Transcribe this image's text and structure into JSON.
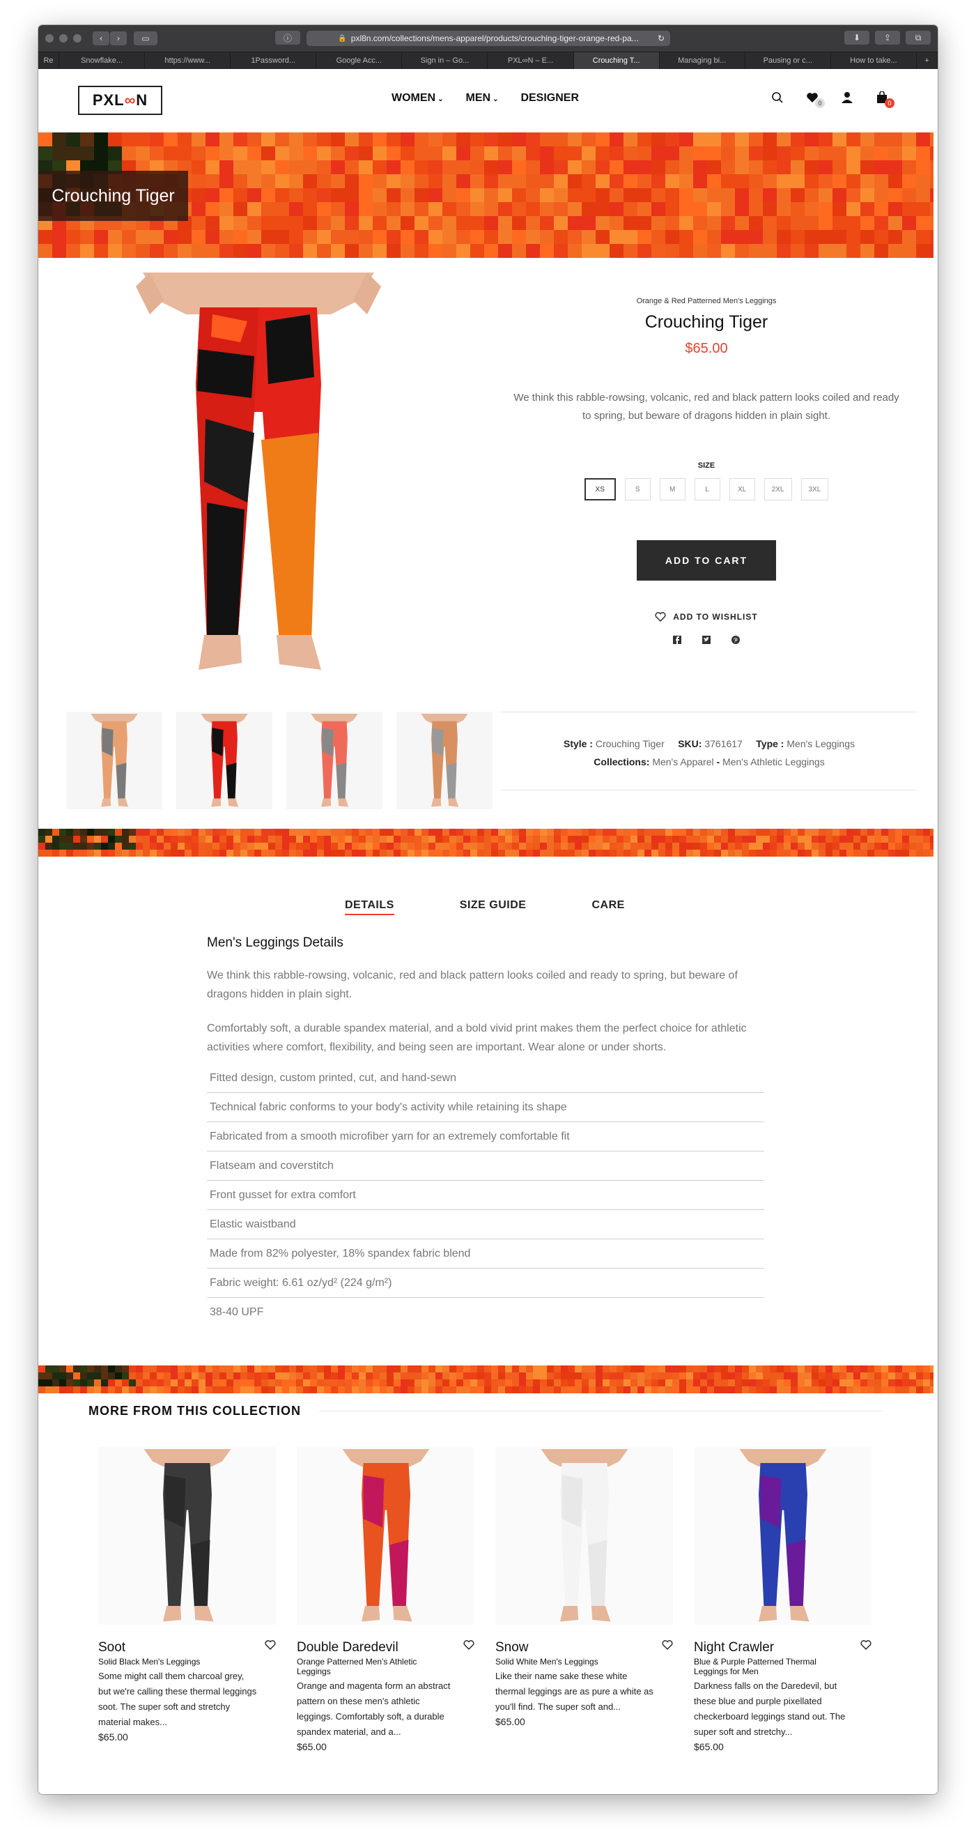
{
  "browser": {
    "url": "pxl8n.com/collections/mens-apparel/products/crouching-tiger-orange-red-pa...",
    "tabs": [
      "Re",
      "Snowflake...",
      "https://www...",
      "1Password...",
      "Google Acc...",
      "Sign in – Go...",
      "PXL∞N – E...",
      "Crouching T...",
      "Managing bi...",
      "Pausing or c...",
      "How to take..."
    ],
    "active_tab": 7,
    "new_tab": "+"
  },
  "header": {
    "logo_left": "PXL",
    "logo_mid": "∞",
    "logo_right": "N",
    "nav": [
      "WOMEN",
      "MEN",
      "DESIGNER"
    ],
    "nav_chevron": "⌄",
    "wishlist_count": "0",
    "cart_count": "0"
  },
  "hero": {
    "title": "Crouching Tiger"
  },
  "product": {
    "subtitle": "Orange & Red Patterned Men's Leggings",
    "title": "Crouching Tiger",
    "price": "$65.00",
    "description": "We think this rabble-rowsing, volcanic, red and black pattern looks coiled and ready to spring, but beware of dragons hidden in plain sight.",
    "size_label": "SIZE",
    "sizes": [
      "XS",
      "S",
      "M",
      "L",
      "XL",
      "2XL",
      "3XL"
    ],
    "selected_size": "XS",
    "add_to_cart": "ADD TO CART",
    "wishlist": "ADD TO WISHLIST",
    "meta": {
      "style_label": "Style :",
      "style_value": "Crouching Tiger",
      "sku_label": "SKU:",
      "sku_value": "3761617",
      "type_label": "Type :",
      "type_value": "Men's Leggings",
      "collections_label": "Collections:",
      "collection_1": "Men's Apparel",
      "collection_sep": "-",
      "collection_2": "Men's Athletic Leggings"
    }
  },
  "details": {
    "tabs": [
      "DETAILS",
      "SIZE GUIDE",
      "CARE"
    ],
    "heading": "Men's Leggings Details",
    "para1": "We think this rabble-rowsing, volcanic, red and black pattern looks coiled and ready to spring, but beware of dragons hidden in plain sight.",
    "para2": "Comfortably soft, a durable spandex material, and a bold vivid print makes them the perfect choice for athletic activities where comfort, flexibility, and being seen are important. Wear alone or under shorts.",
    "features": [
      "Fitted design, custom printed, cut, and hand-sewn",
      "Technical fabric conforms to your body's activity while retaining its shape",
      "Fabricated from a smooth microfiber yarn for an extremely comfortable fit",
      "Flatseam and coverstitch",
      "Front gusset for extra comfort",
      "Elastic waistband",
      "Made from 82% polyester, 18% spandex fabric blend",
      "Fabric weight: 6.61 oz/yd² (224 g/m²)",
      "38-40 UPF"
    ]
  },
  "collection": {
    "heading": "MORE FROM THIS COLLECTION",
    "items": [
      {
        "title": "Soot",
        "subtitle": "Solid Black Men's Leggings",
        "desc": "Some might call them charcoal grey, but we're calling these thermal leggings soot. The super soft and stretchy material makes...",
        "price": "$65.00",
        "color": "#3a3a3a"
      },
      {
        "title": "Double Daredevil",
        "subtitle": "Orange Patterned Men's Athletic Leggings",
        "desc": "Orange and magenta form an abstract pattern on these men's athletic leggings. Comfortably soft, a durable spandex material, and a...",
        "price": "$65.00",
        "color": "#e8531f"
      },
      {
        "title": "Snow",
        "subtitle": "Solid White Men's Leggings",
        "desc": "Like their name sake these white thermal leggings are as pure a white as you'll find. The super soft and...",
        "price": "$65.00",
        "color": "#f4f4f4"
      },
      {
        "title": "Night Crawler",
        "subtitle": "Blue & Purple Patterned Thermal Leggings for Men",
        "desc": "Darkness falls on the Daredevil, but these blue and purple pixellated checkerboard leggings stand out. The super soft and stretchy...",
        "price": "$65.00",
        "color": "#2a3fb0"
      }
    ]
  },
  "colors": {
    "accent": "#e8412c",
    "banner_orange": "#f05a1a",
    "dark": "#2c2c2c"
  }
}
